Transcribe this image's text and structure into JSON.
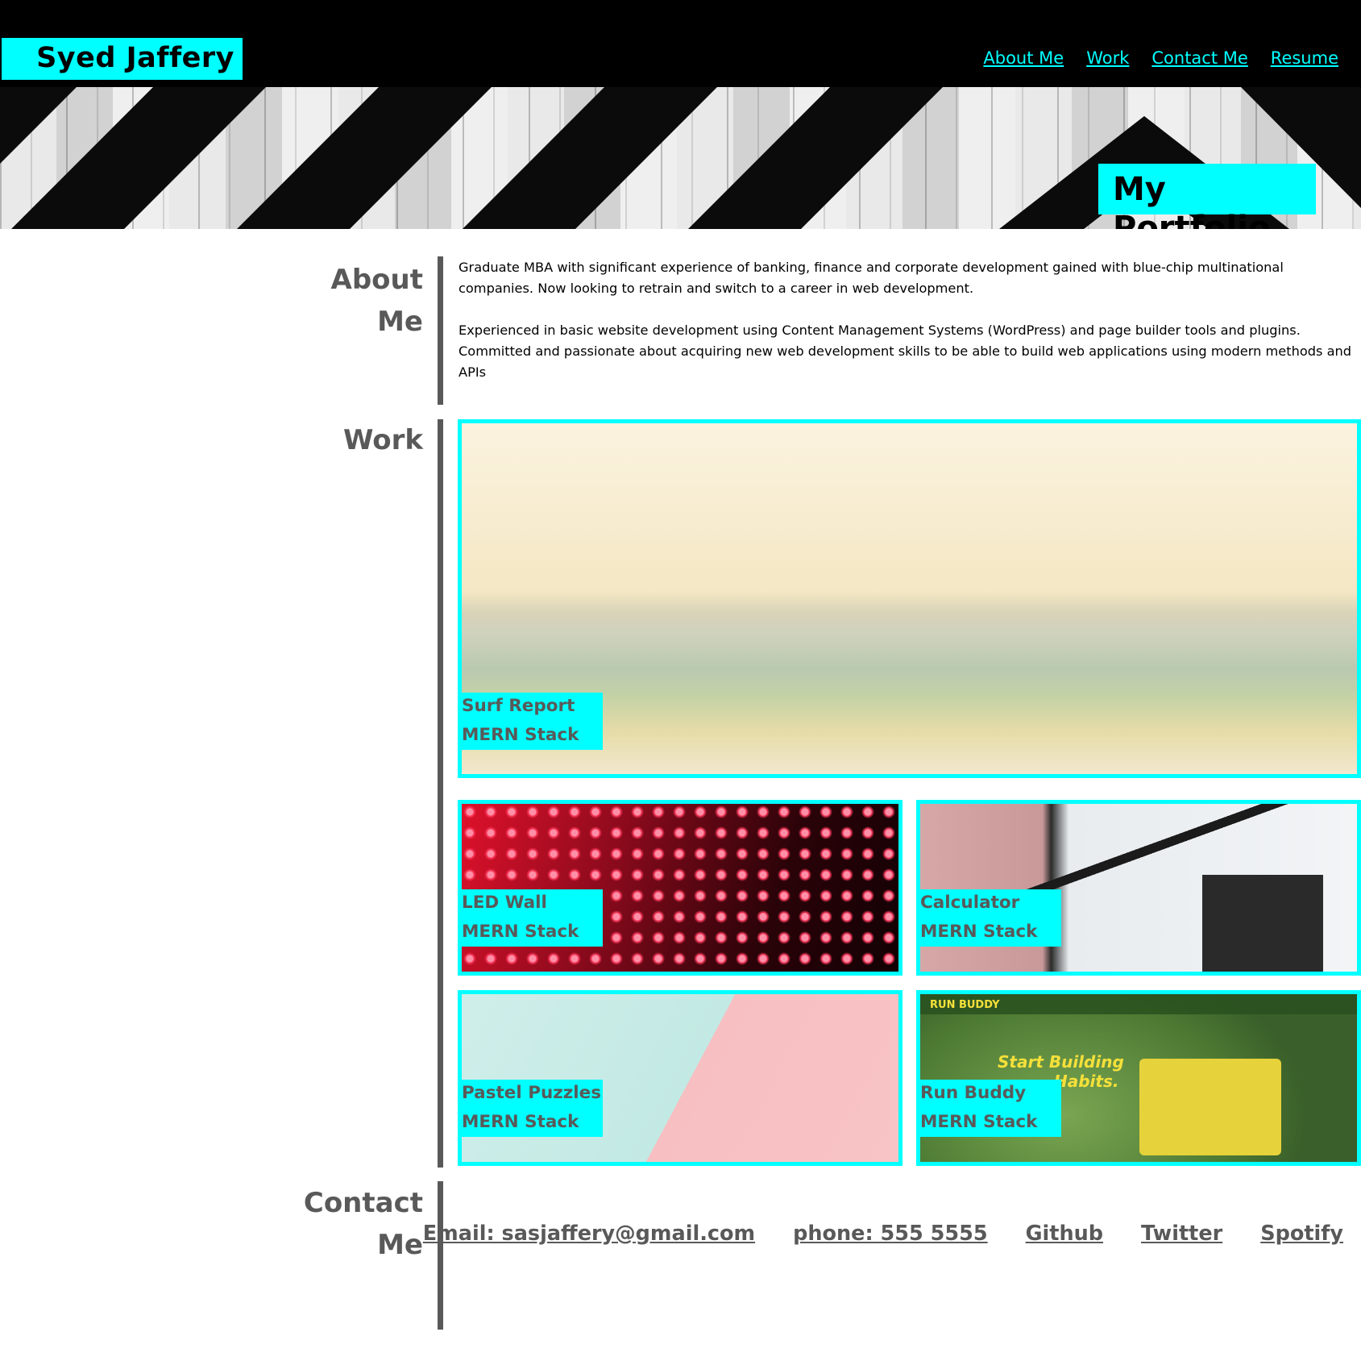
{
  "header": {
    "name": "Syed Jaffery",
    "nav": [
      "About Me",
      "Work",
      "Contact Me",
      "Resume"
    ]
  },
  "hero": {
    "title": "My Portfolio"
  },
  "about": {
    "title_line1": "About",
    "title_line2": "Me",
    "paragraph1": "Graduate MBA with significant experience of banking, finance and corporate development gained with blue-chip multinational companies. Now looking to retrain and switch to a career in web development.",
    "paragraph2": "Experienced in basic website development using Content Management Systems (WordPress) and page builder tools and plugins. Committed and passionate about acquiring new web development skills to be able to build web applications using modern methods and APIs"
  },
  "work": {
    "title": "Work",
    "cards": [
      {
        "name": "Surf Report",
        "stack": "MERN Stack"
      },
      {
        "name": "LED Wall",
        "stack": "MERN Stack"
      },
      {
        "name": "Calculator",
        "stack": "MERN Stack"
      },
      {
        "name": "Pastel Puzzles",
        "stack": "MERN Stack"
      },
      {
        "name": "Run Buddy",
        "stack": "MERN Stack"
      }
    ],
    "run_buddy_image": {
      "brand": "RUN BUDDY",
      "headline_line1": "Start Building",
      "headline_line2": "Habits."
    }
  },
  "contact": {
    "title_line1": "Contact",
    "title_line2": "Me",
    "links": [
      "Email: sasjaffery@gmail.com",
      "phone: 555 5555",
      "Github",
      "Twitter",
      "Spotify"
    ]
  },
  "colors": {
    "accent": "#00ffff",
    "header_bg": "#000000",
    "section_text": "#595959"
  },
  "icons": []
}
